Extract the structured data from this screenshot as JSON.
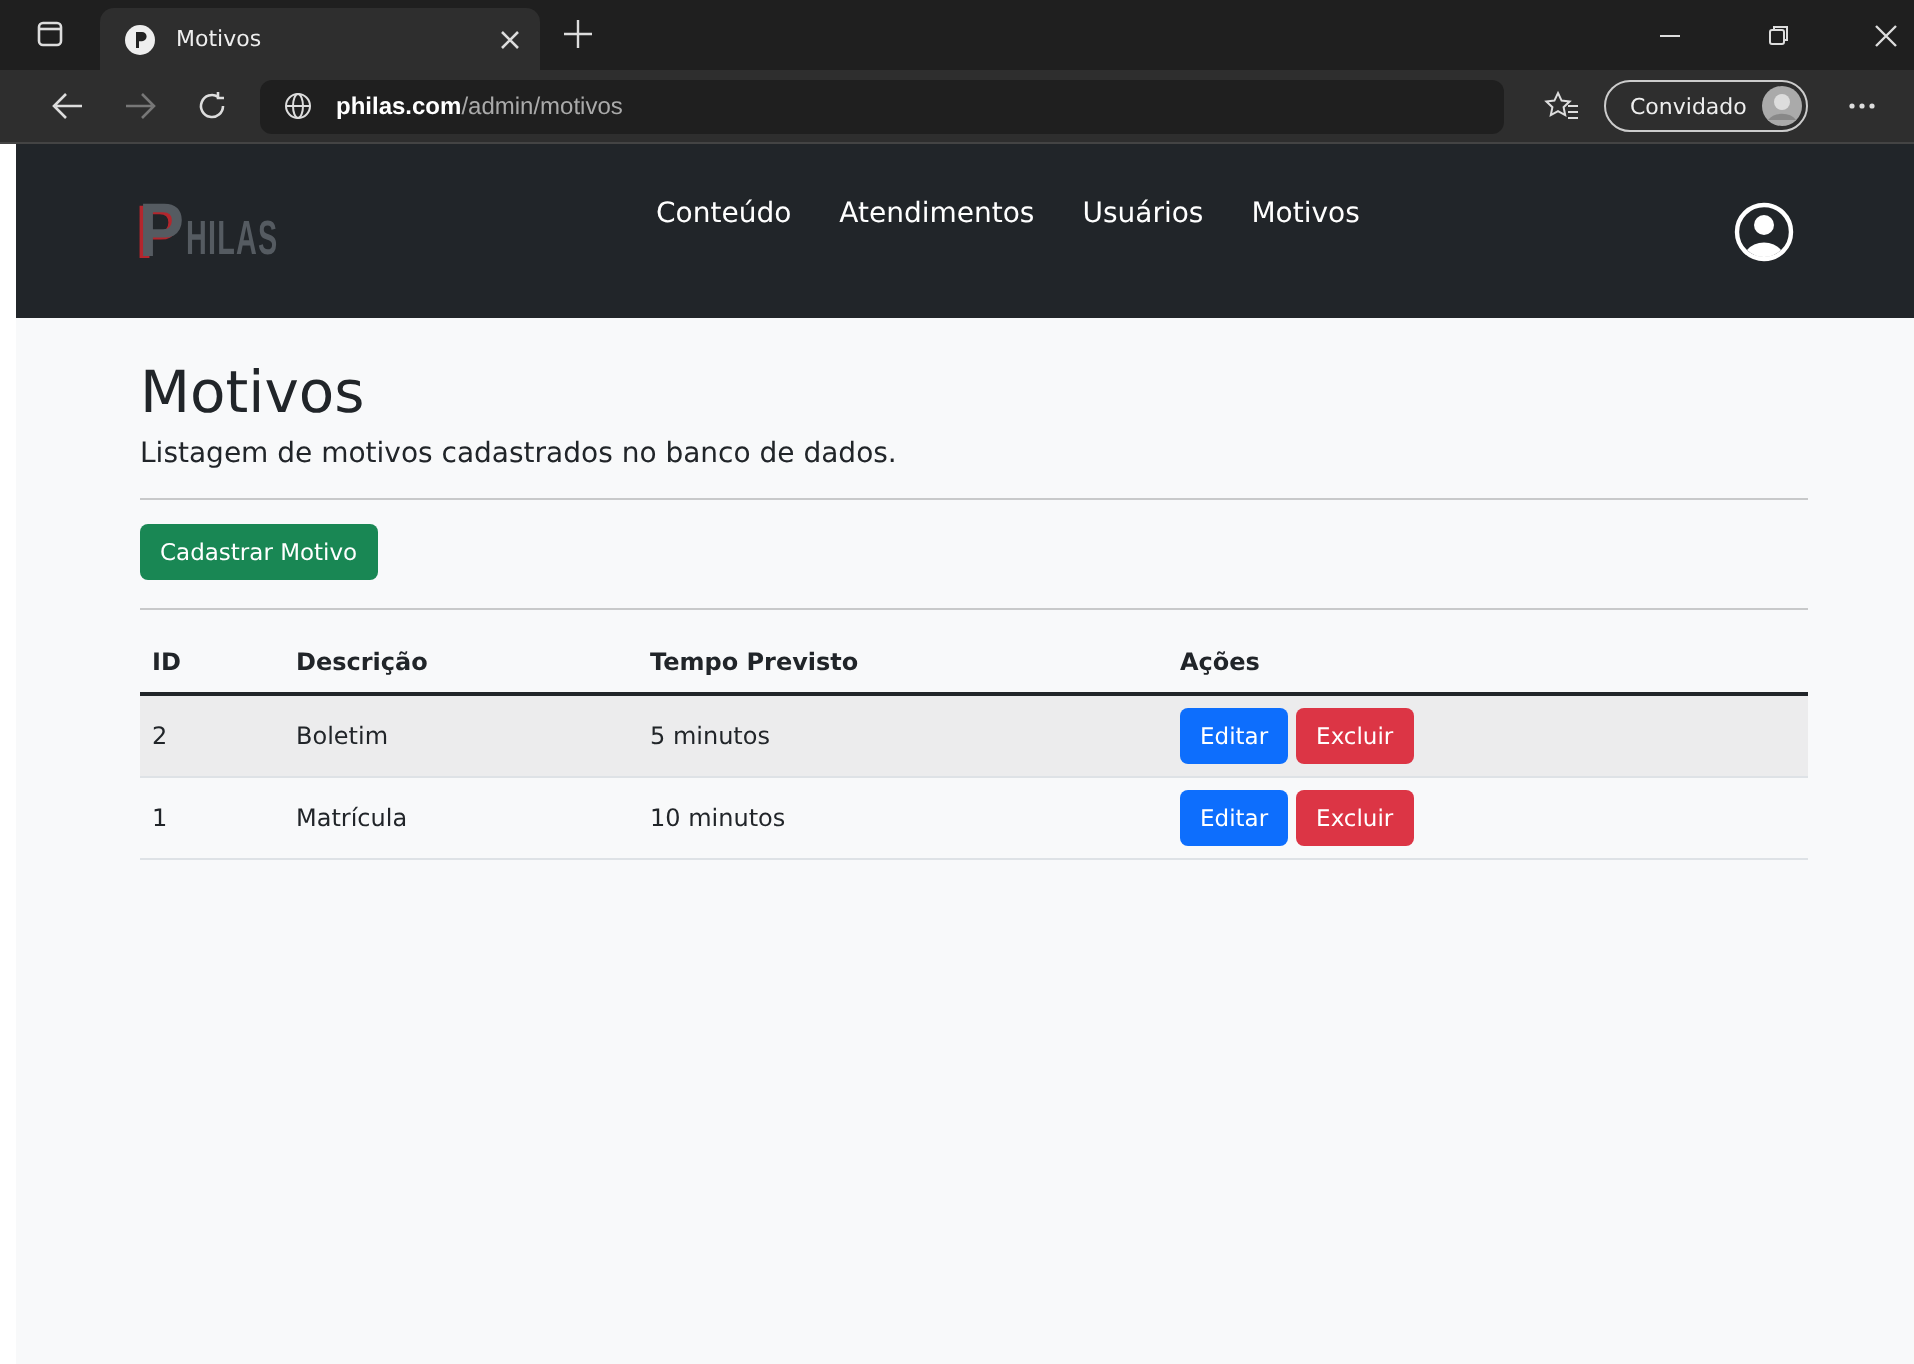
{
  "browser": {
    "tab_title": "Motivos",
    "url_host": "philas.com",
    "url_path": "/admin/motivos",
    "profile": "Convidado"
  },
  "navbar": {
    "logo": "PHILAS",
    "links": [
      "Conteúdo",
      "Atendimentos",
      "Usuários",
      "Motivos"
    ]
  },
  "page": {
    "title": "Motivos",
    "subtitle": "Listagem de motivos cadastrados no banco de dados.",
    "create_button": "Cadastrar Motivo"
  },
  "table": {
    "columns": [
      "ID",
      "Descrição",
      "Tempo Previsto",
      "Ações"
    ],
    "rows": [
      {
        "id": "2",
        "description": "Boletim",
        "time": "5 minutos",
        "edit": "Editar",
        "delete": "Excluir"
      },
      {
        "id": "1",
        "description": "Matrícula",
        "time": "10 minutos",
        "edit": "Editar",
        "delete": "Excluir"
      }
    ]
  }
}
